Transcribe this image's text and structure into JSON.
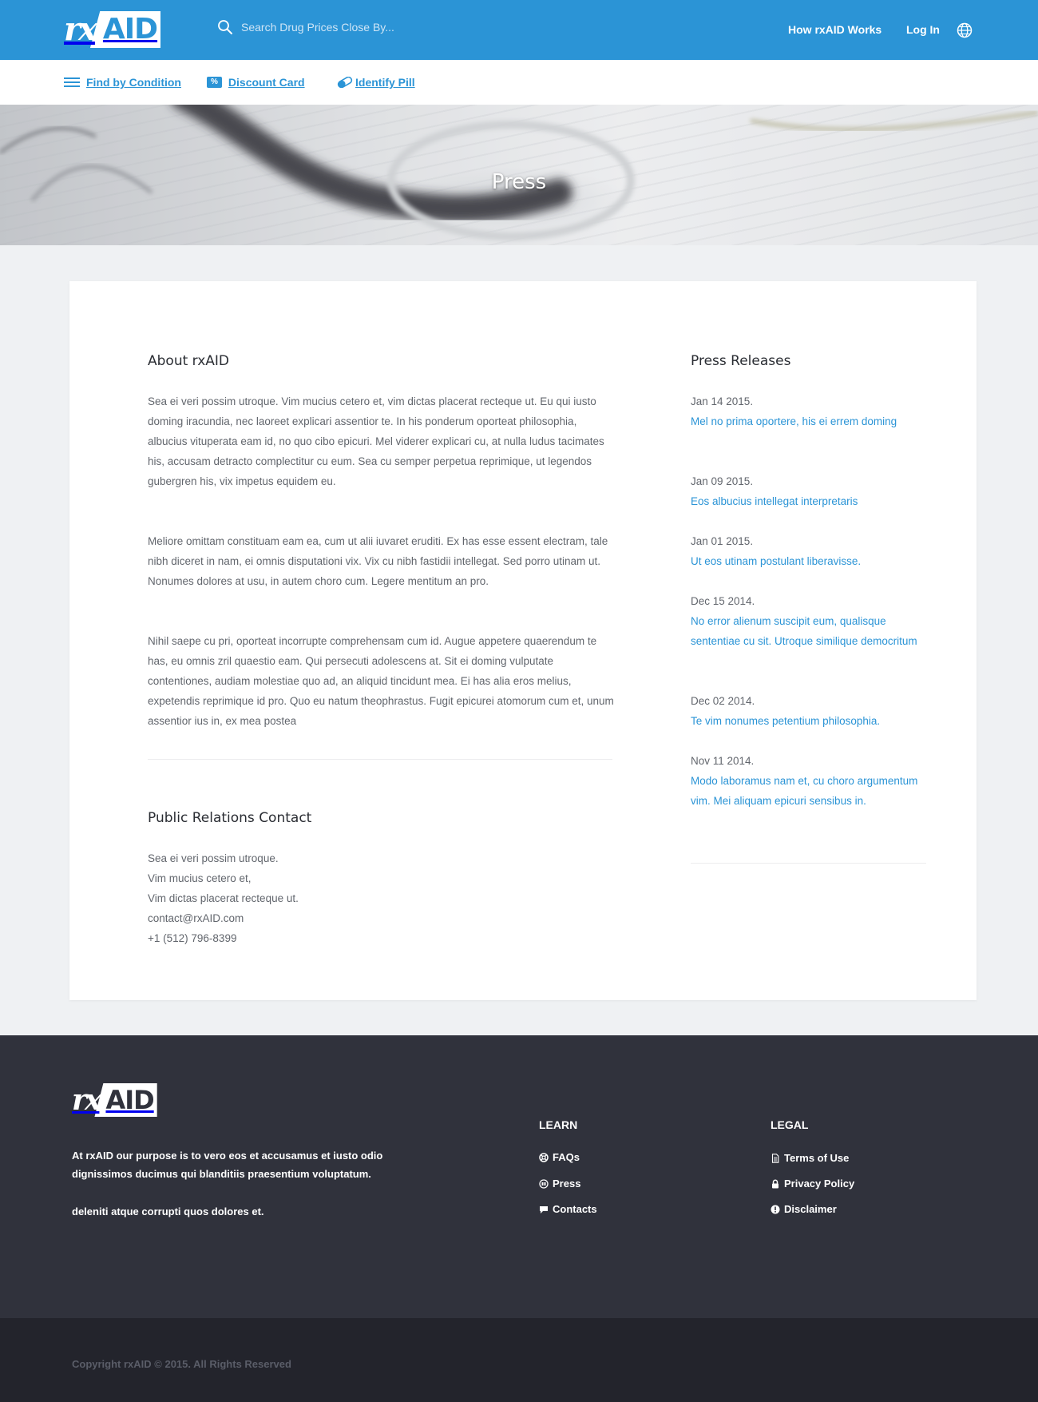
{
  "header": {
    "logo_rx": "rx",
    "logo_aid": "AID",
    "search_placeholder": "Search Drug Prices Close By...",
    "nav": [
      "How rxAID Works",
      "Log In"
    ],
    "language_icon": "globe-icon"
  },
  "subnav": {
    "find_by_condition": "Find by Condition",
    "discount_badge": "%",
    "discount_card": "Discount Card",
    "identify_pill": "Identify Pill"
  },
  "hero": {
    "title": "Press"
  },
  "about": {
    "title": "About rxAID",
    "paragraphs": [
      "Sea ei veri possim utroque. Vim mucius cetero et, vim dictas placerat recteque ut. Eu qui iusto doming iracundia, nec laoreet explicari assentior te. In his ponderum oporteat philosophia, albucius vituperata eam id, no quo cibo epicuri. Mel viderer explicari cu, at nulla ludus tacimates his, accusam detracto complectitur cu eum. Sea cu semper perpetua reprimique, ut legendos gubergren his, vix impetus equidem eu.",
      "Meliore omittam constituam eam ea, cum ut alii iuvaret eruditi. Ex has esse essent electram, tale nibh diceret in nam, ei omnis disputationi vix. Vix cu nibh fastidii intellegat. Sed porro utinam ut. Nonumes dolores at usu, in autem choro cum. Legere mentitum an pro.",
      "Nihil saepe cu pri, oporteat incorrupte comprehensam cum id. Augue appetere quaerendum te has, eu omnis zril quaestio eam. Qui persecuti adolescens at. Sit ei doming vulputate contentiones, audiam molestiae quo ad, an aliquid tincidunt mea. Ei has alia eros melius, expetendis reprimique id pro. Quo eu natum theophrastus. Fugit epicurei atomorum cum et, unum assentior ius in, ex mea postea"
    ]
  },
  "pr_contact": {
    "title": "Public Relations Contact",
    "lines": [
      "Sea ei veri possim utroque.",
      "Vim mucius cetero et,",
      "Vim dictas placerat recteque ut.",
      "contact@rxAID.com",
      "+1 (512) 796-8399"
    ]
  },
  "press_releases": {
    "title": "Press Releases",
    "items": [
      {
        "date": "Jan 14 2015.",
        "title": "Mel no prima oportere, his ei errem doming"
      },
      {
        "date": "Jan 09 2015.",
        "title": "Eos albucius intellegat interpretaris"
      },
      {
        "date": "Jan 01 2015.",
        "title": "Ut eos utinam postulant liberavisse."
      },
      {
        "date": "Dec 15 2014.",
        "title": "No error alienum suscipit eum, qualisque sententiae cu sit. Utroque similique democritum"
      },
      {
        "date": "Dec 02 2014.",
        "title": "Te vim nonumes petentium philosophia."
      },
      {
        "date": "Nov 11 2014.",
        "title": "Modo laboramus nam et, cu choro argumentum vim. Mei aliquam epicuri sensibus in."
      }
    ]
  },
  "footer": {
    "logo_rx": "rx",
    "logo_aid": "AID",
    "about_text": "At rxAID our purpose is to vero eos et accusamus et iusto odio dignissimos ducimus qui blanditiis praesentium voluptatum.",
    "about_text_2": "deleniti atque corrupti quos dolores et.",
    "learn": {
      "title": "LEARN",
      "links": [
        {
          "label": "FAQs",
          "icon": "lifebuoy-icon"
        },
        {
          "label": "Press",
          "icon": "press-icon"
        },
        {
          "label": "Contacts",
          "icon": "chat-bubble-icon"
        }
      ]
    },
    "legal": {
      "title": "LEGAL",
      "links": [
        {
          "label": "Terms of Use",
          "icon": "document-icon"
        },
        {
          "label": "Privacy Policy",
          "icon": "lock-icon"
        },
        {
          "label": "Disclaimer",
          "icon": "info-icon"
        }
      ]
    },
    "copyright": "Copyright rxAID © 2015. All Rights Reserved"
  },
  "colors": {
    "brand_blue": "#2b94d6",
    "footer_bg": "#30323c",
    "bottom_bar_bg": "#23242c",
    "page_bg": "#eff1f3"
  }
}
